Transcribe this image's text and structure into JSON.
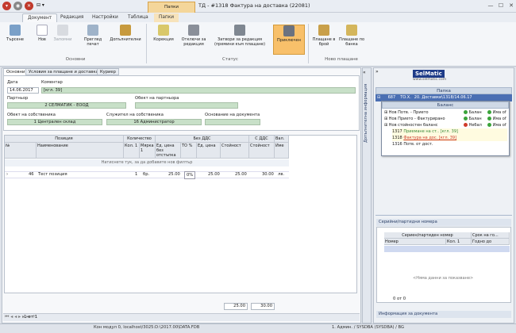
{
  "window": {
    "title": "ТД - #1318 Фактура на доставка (22081)",
    "context_group": "Папки"
  },
  "tabs": [
    "Документ",
    "Редакция",
    "Настройки",
    "Таблица",
    "Папки"
  ],
  "ribbon": {
    "groups": [
      {
        "label": "Основни",
        "buttons": [
          "Търсене",
          "Нов",
          "Запомни",
          "Преглед печат",
          "Допълнителни"
        ]
      },
      {
        "label": "Статус",
        "buttons": [
          "Корекция",
          "Отключи за редакция",
          "Затвори за редакция (премини към плащане)",
          "Приключен"
        ]
      },
      {
        "label": "Ново плащане",
        "buttons": [
          "Плащане в брой",
          "Плащане по банка"
        ]
      }
    ]
  },
  "subtabs": [
    "Основни",
    "Условия за плащане и доставка",
    "Куриер"
  ],
  "form": {
    "date_label": "Дата",
    "date_value": "14.06.2017",
    "comment_label": "Коментар",
    "comment_value": "[кгл. 39]",
    "partner_label": "Партньор",
    "partner_value": "2 СЕЛМАТИК - ЕООД",
    "partner_object_label": "Обект на партньора",
    "owner_object_label": "Обект на собственика",
    "owner_object_value": "1 Централен склад",
    "owner_employee_label": "Служител на собственика",
    "owner_employee_value": "16 Администратор",
    "doc_basis_label": "Основание на документа"
  },
  "grid": {
    "group_headers": {
      "position": "Позиция",
      "quantity": "Количество",
      "no_vat": "Без ДДС",
      "with_vat": "С ДДС",
      "currency": "Вал."
    },
    "columns": [
      "№",
      "Наименование",
      "Кол. 1",
      "Мярка 1",
      "Ед. цена без отстъпка",
      "ТО %",
      "Ед. цена",
      "Стойност",
      "Стойност",
      "Име"
    ],
    "filter_hint": "Натиснете тук, за да добавите нов филтър",
    "rows": [
      {
        "no": "46",
        "name": "Тест позиция",
        "qty": "1",
        "unit": "бр.",
        "price_nodisc": "25.00",
        "disc": "0%",
        "price": "25.00",
        "value": "25.00",
        "value_vat": "30.00",
        "currency": "лв."
      }
    ],
    "total_novat": "25.00",
    "total_vat": "30.00",
    "pager": "1 от 1"
  },
  "right_panel": {
    "logo_text": "SelMatic",
    "logo_url": "www.selmatic.com",
    "folder_header": "Папка",
    "folder_row": {
      "num": "687",
      "type": "ТО.Х.",
      "text": "20. Доставки\\1318/14.06.17"
    },
    "balance_header": "Баланс",
    "balance_rows": [
      {
        "label": "Нов Потв. - Приетo",
        "status": "Балан",
        "extra": "Има оf",
        "color": "#3aa33a"
      },
      {
        "label": "Нов Приетo - Фактурирано",
        "status": "Балан",
        "extra": "Има оf",
        "color": "#3aa33a"
      },
      {
        "label": "Нов стойностен баланс",
        "status": "Небал",
        "extra": "Има оf",
        "color": "#d03a2a"
      }
    ],
    "docs": [
      {
        "num": "1317",
        "text": "Приемане на ст.. [кгл. 39]",
        "color": "#3a8a3a"
      },
      {
        "num": "1318",
        "text": "Фактура на дос. [кгл. 39]",
        "color": "#cc3a2a"
      },
      {
        "num": "1316",
        "text": "Потв. от дост.",
        "color": "#222"
      }
    ],
    "serial_header": "Серийни/партидни номера",
    "serial_columns": [
      "Сериен/партиден номер",
      "Срок на го..."
    ],
    "serial_subcolumns": [
      "Номер",
      "Кол. 1",
      "Годно до"
    ],
    "serial_empty": "<Няма данни за показване>",
    "serial_pager": "0 от 0",
    "doc_info": "Информация за документа",
    "side_tab": "Допълнителна информация"
  },
  "status": {
    "connection": "Кон модул 0, localhost/3025:D:\\2017.00\\DATA.FDB",
    "user": "1. Админ. / SYSDBA (SYSDBA) / BG"
  }
}
